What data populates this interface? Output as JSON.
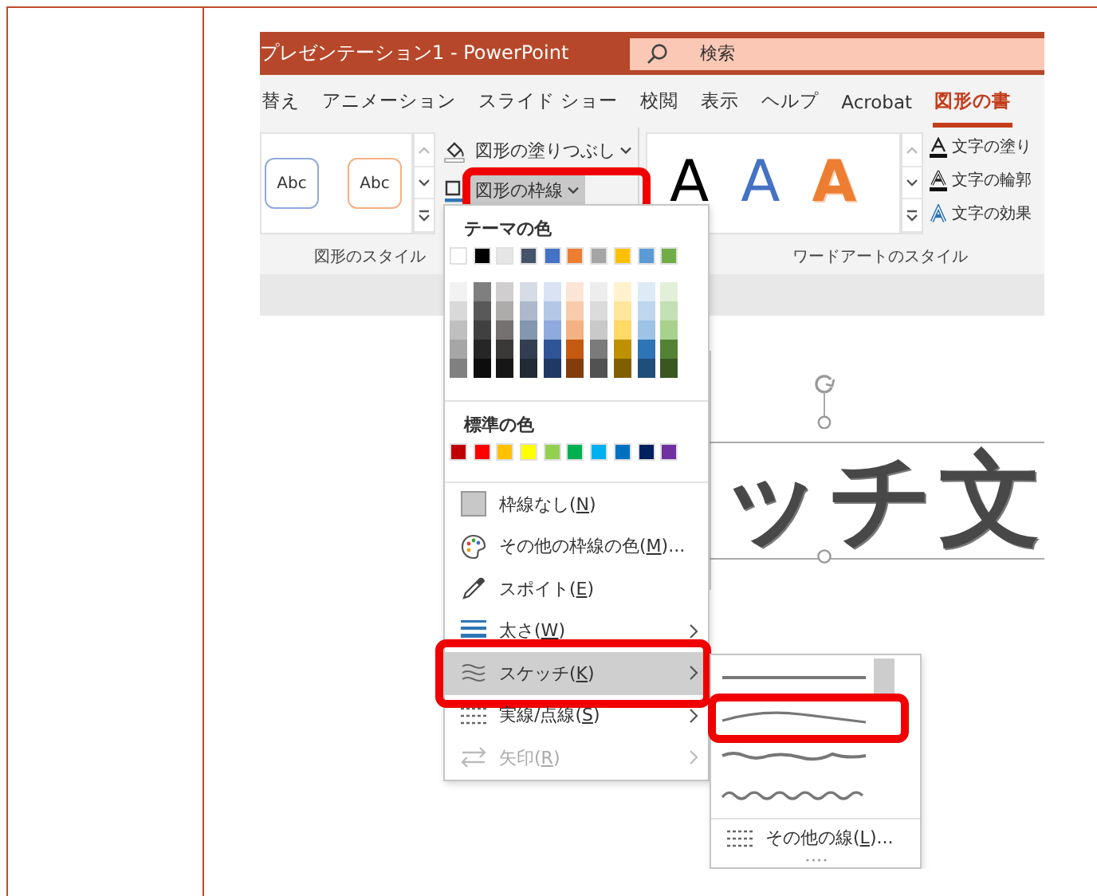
{
  "window": {
    "title": "プレゼンテーション1 - PowerPoint"
  },
  "search": {
    "placeholder": "検索"
  },
  "tabs": [
    {
      "label": "替え",
      "selected": false
    },
    {
      "label": "アニメーション",
      "selected": false
    },
    {
      "label": "スライド ショー",
      "selected": false
    },
    {
      "label": "校閲",
      "selected": false
    },
    {
      "label": "表示",
      "selected": false
    },
    {
      "label": "ヘルプ",
      "selected": false
    },
    {
      "label": "Acrobat",
      "selected": false
    },
    {
      "label": "図形の書",
      "selected": true
    }
  ],
  "shape_styles": {
    "label": "図形のスタイル",
    "presets": [
      {
        "text": "Abc",
        "color": "#8faadc"
      },
      {
        "text": "Abc",
        "color": "#f4b183"
      }
    ]
  },
  "shape_commands": [
    {
      "kind": "fill",
      "label": "図形の塗りつぶし",
      "selected": false,
      "annotated": false
    },
    {
      "kind": "outline",
      "label": "図形の枠線",
      "selected": true,
      "annotated": true
    }
  ],
  "wordart": {
    "label": "ワードアートのスタイル",
    "presets": [
      {
        "kind": "filled",
        "text": "A",
        "color": "#000000"
      },
      {
        "kind": "filled",
        "text": "A",
        "color": "#4472c4"
      },
      {
        "kind": "outline",
        "text": "A",
        "color": "#ed7d31"
      }
    ],
    "commands": [
      {
        "kind": "fill",
        "label": "文字の塗り"
      },
      {
        "kind": "outline",
        "label": "文字の輪郭"
      },
      {
        "kind": "effects",
        "label": "文字の効果"
      }
    ]
  },
  "slide": {
    "text": "ッチ文"
  },
  "outline_menu": {
    "theme_heading": "テーマの色",
    "theme_colors": [
      {
        "color": "#ffffff"
      },
      {
        "color": "#000000"
      },
      {
        "color": "#e7e6e6"
      },
      {
        "color": "#44546a"
      },
      {
        "color": "#4472c4"
      },
      {
        "color": "#ed7d31"
      },
      {
        "color": "#a5a5a5"
      },
      {
        "color": "#ffc000"
      },
      {
        "color": "#5b9bd5"
      },
      {
        "color": "#70ad47"
      }
    ],
    "shade_columns": [
      {
        "shades": [
          {
            "color": "#f2f2f2"
          },
          {
            "color": "#d9d9d9"
          },
          {
            "color": "#bfbfbf"
          },
          {
            "color": "#a6a6a6"
          },
          {
            "color": "#808080"
          }
        ]
      },
      {
        "shades": [
          {
            "color": "#7f7f7f"
          },
          {
            "color": "#595959"
          },
          {
            "color": "#404040"
          },
          {
            "color": "#262626"
          },
          {
            "color": "#0d0d0d"
          }
        ]
      },
      {
        "shades": [
          {
            "color": "#d0cece"
          },
          {
            "color": "#aeabab"
          },
          {
            "color": "#757171"
          },
          {
            "color": "#3b3838"
          },
          {
            "color": "#171616"
          }
        ]
      },
      {
        "shades": [
          {
            "color": "#d6dce5"
          },
          {
            "color": "#adb9ca"
          },
          {
            "color": "#8497b0"
          },
          {
            "color": "#333f50"
          },
          {
            "color": "#222a35"
          }
        ]
      },
      {
        "shades": [
          {
            "color": "#dae3f3"
          },
          {
            "color": "#b4c7e7"
          },
          {
            "color": "#8faadc"
          },
          {
            "color": "#2f5597"
          },
          {
            "color": "#203864"
          }
        ]
      },
      {
        "shades": [
          {
            "color": "#fbe5d6"
          },
          {
            "color": "#f8cbad"
          },
          {
            "color": "#f4b183"
          },
          {
            "color": "#c55a11"
          },
          {
            "color": "#843c0c"
          }
        ]
      },
      {
        "shades": [
          {
            "color": "#ededed"
          },
          {
            "color": "#dbdbdb"
          },
          {
            "color": "#c9c9c9"
          },
          {
            "color": "#7b7b7b"
          },
          {
            "color": "#525252"
          }
        ]
      },
      {
        "shades": [
          {
            "color": "#fff2cc"
          },
          {
            "color": "#ffe699"
          },
          {
            "color": "#ffd966"
          },
          {
            "color": "#bf9000"
          },
          {
            "color": "#7f6000"
          }
        ]
      },
      {
        "shades": [
          {
            "color": "#deebf7"
          },
          {
            "color": "#bdd7ee"
          },
          {
            "color": "#9dc3e6"
          },
          {
            "color": "#2e75b6"
          },
          {
            "color": "#1f4e79"
          }
        ]
      },
      {
        "shades": [
          {
            "color": "#e2f0d9"
          },
          {
            "color": "#c5e0b4"
          },
          {
            "color": "#a9d18e"
          },
          {
            "color": "#548235"
          },
          {
            "color": "#385723"
          }
        ]
      }
    ],
    "standard_heading": "標準の色",
    "standard_colors": [
      {
        "color": "#c00000"
      },
      {
        "color": "#ff0000"
      },
      {
        "color": "#ffc000"
      },
      {
        "color": "#ffff00"
      },
      {
        "color": "#92d050"
      },
      {
        "color": "#00b050"
      },
      {
        "color": "#00b0f0"
      },
      {
        "color": "#0070c0"
      },
      {
        "color": "#002060"
      },
      {
        "color": "#7030a0"
      }
    ],
    "items": [
      {
        "kind": "no-outline",
        "before": "枠線なし(",
        "key": "N",
        "after": ")",
        "disabled": false,
        "submenu": false,
        "selected": false,
        "annotated": false
      },
      {
        "kind": "palette",
        "before": "その他の枠線の色(",
        "key": "M",
        "after": ")...",
        "disabled": false,
        "submenu": false,
        "selected": false,
        "annotated": false
      },
      {
        "kind": "eyedropper",
        "before": "スポイト(",
        "key": "E",
        "after": ")",
        "disabled": false,
        "submenu": false,
        "selected": false,
        "annotated": false
      },
      {
        "kind": "weight",
        "before": "太さ(",
        "key": "W",
        "after": ")",
        "disabled": false,
        "submenu": true,
        "selected": false,
        "annotated": false
      },
      {
        "kind": "sketch",
        "before": "スケッチ(",
        "key": "K",
        "after": ")",
        "disabled": false,
        "submenu": true,
        "selected": true,
        "annotated": true
      },
      {
        "kind": "dash",
        "before": "実線/点線(",
        "key": "S",
        "after": ")",
        "disabled": false,
        "submenu": true,
        "selected": false,
        "annotated": false
      },
      {
        "kind": "arrows",
        "before": "矢印(",
        "key": "R",
        "after": ")",
        "disabled": true,
        "submenu": true,
        "selected": false,
        "annotated": false
      }
    ]
  },
  "sketch_menu": {
    "styles": [
      {
        "kind": "straight",
        "annotated": false
      },
      {
        "kind": "curved",
        "annotated": true
      },
      {
        "kind": "rough",
        "annotated": false
      },
      {
        "kind": "wavy",
        "annotated": false
      }
    ],
    "more": {
      "before": "その他の線(",
      "key": "L",
      "after": ")..."
    }
  }
}
